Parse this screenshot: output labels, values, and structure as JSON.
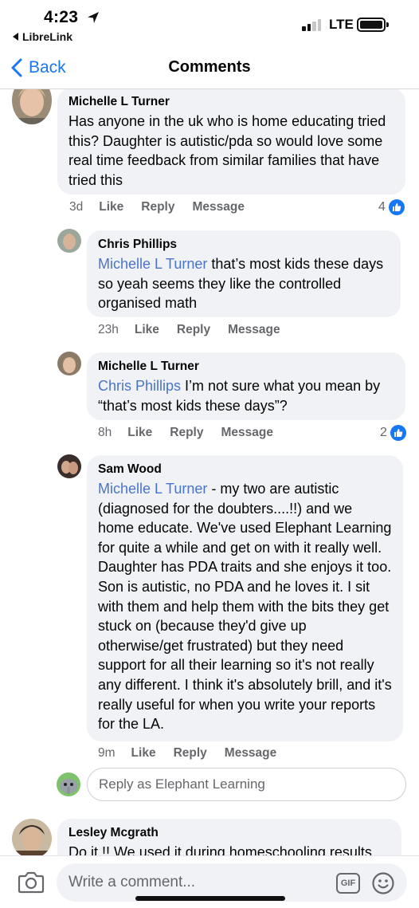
{
  "status_bar": {
    "time": "4:23",
    "back_app": "LibreLink",
    "network": "LTE"
  },
  "nav": {
    "back_label": "Back",
    "title": "Comments"
  },
  "comments": [
    {
      "author": "Michelle L Turner",
      "text": "Has anyone in the uk who is home educating tried this? Daughter is autistic/pda so would love some real time feedback from similar families that have tried this",
      "age": "3d",
      "actions": [
        "Like",
        "Reply",
        "Message"
      ],
      "reactions": "4"
    },
    {
      "author": "Chris Phillips",
      "mention": "Michelle L Turner",
      "text": " that’s most kids these days so yeah seems they like the controlled organised math",
      "age": "23h",
      "actions": [
        "Like",
        "Reply",
        "Message"
      ]
    },
    {
      "author": "Michelle L Turner",
      "mention": "Chris Phillips",
      "text": " I’m not sure what you mean by “that’s most kids these days”?",
      "age": "8h",
      "actions": [
        "Like",
        "Reply",
        "Message"
      ],
      "reactions": "2"
    },
    {
      "author": "Sam Wood",
      "mention": "Michelle L Turner",
      "text": " - my two are autistic (diagnosed for the doubters....!!) and we home educate. We've used Elephant Learning for quite a while and get on with it really well. Daughter has PDA traits and she enjoys it too. Son is autistic, no PDA and he loves it. I sit with them and help them with the bits they get stuck on (because they'd give up otherwise/get frustrated) but they need support for all their learning so it's not really any different. I think it's absolutely brill, and it's really useful for when you write your reports for the LA.",
      "age": "9m",
      "actions": [
        "Like",
        "Reply",
        "Message"
      ]
    },
    {
      "author": "Lesley Mcgrath",
      "text": "Do it !! We used it during homeschooling.results"
    }
  ],
  "reply_box": {
    "placeholder": "Reply as Elephant Learning"
  },
  "composer": {
    "placeholder": "Write a comment...",
    "gif_label": "GIF"
  },
  "colors": {
    "accent": "#1877f2",
    "mention": "#4a74c9",
    "bubble": "#f0f2f5",
    "meta": "#65676b"
  }
}
